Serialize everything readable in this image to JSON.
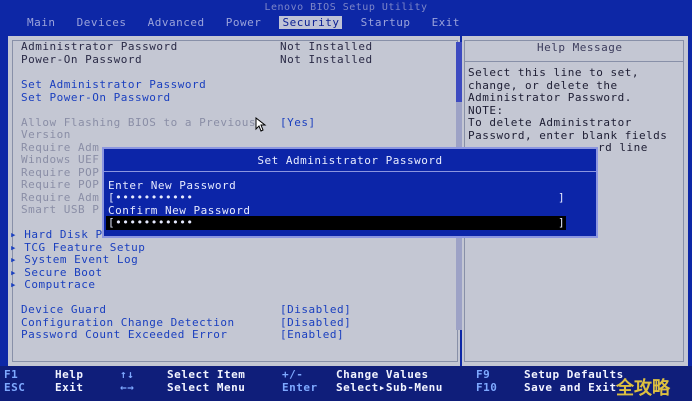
{
  "app": {
    "title": "Lenovo BIOS Setup Utility"
  },
  "menu": [
    "Main",
    "Devices",
    "Advanced",
    "Power",
    "Security",
    "Startup",
    "Exit"
  ],
  "active_menu": "Security",
  "settings": {
    "admin_password": {
      "label": "Administrator Password",
      "value": "Not Installed"
    },
    "poweron_password": {
      "label": "Power-On Password",
      "value": "Not Installed"
    },
    "set_admin": "Set Administrator Password",
    "set_poweron": "Set Power-On Password",
    "allow_flash": {
      "label": "Allow Flashing BIOS to a Previous",
      "value": "[Yes]"
    },
    "version": "Version",
    "require_adm1": "Require Adm",
    "windows_uefi": "Windows UEF",
    "require_pop1": "Require POP",
    "require_pop2": "Require POP",
    "require_adm2": "Require Adm",
    "smart_usb": "Smart USB P",
    "hard_disk": "▸ Hard Disk P",
    "tcg": "▸ TCG Feature Setup",
    "event_log": "▸ System Event Log",
    "secure_boot": "▸ Secure Boot",
    "computrace": "▸ Computrace",
    "device_guard": {
      "label": "Device Guard",
      "value": "[Disabled]"
    },
    "config_change": {
      "label": "Configuration Change Detection",
      "value": "[Disabled]"
    },
    "pwd_count": {
      "label": "Password Count Exceeded Error",
      "value": "[Enabled]"
    }
  },
  "help": {
    "title": "Help Message",
    "lines": [
      "Select this line to set,",
      "change, or delete the",
      "Administrator Password.",
      "NOTE:",
      "To delete Administrator",
      "Password, enter blank fields",
      "rd line"
    ]
  },
  "dialog": {
    "title": "Set Administrator Password",
    "enter_label": "Enter New Password",
    "enter_value": "[•••••••••••",
    "enter_close": "]",
    "confirm_label": "Confirm New Password",
    "confirm_value": "[•••••••••••",
    "confirm_close": "]"
  },
  "footer": {
    "f1": "F1",
    "help": "Help",
    "esc": "ESC",
    "exit": "Exit",
    "updown": "↑↓",
    "select_item": "Select Item",
    "leftright": "←→",
    "select_menu": "Select Menu",
    "plusminus": "+/-",
    "change_values": "Change Values",
    "enter": "Enter",
    "select_sub": "Select▸Sub-Menu",
    "f9": "F9",
    "setup_defaults": "Setup Defaults",
    "f10": "F10",
    "save_exit": "Save and Exit"
  },
  "watermark": "全攻略"
}
